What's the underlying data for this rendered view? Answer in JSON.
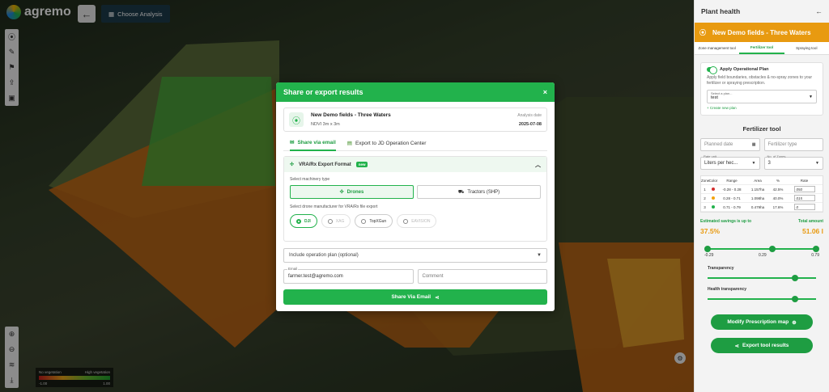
{
  "topbar": {
    "logo_text": "agremo",
    "back_icon": "arrow-left-icon",
    "choose_label": "Choose Analysis"
  },
  "legend": {
    "left": "No vegetation",
    "right": "High vegetation",
    "min": "-1.00",
    "max": "1.00"
  },
  "modal": {
    "title": "Share or export results",
    "close": "×",
    "field_name": "New Demo fields - Three Waters",
    "field_sub": "NDVI 3m x 3m",
    "date_label": "Analysis date",
    "date_value": "2025-07-08",
    "tabs": [
      "Share via email",
      "Export to JD Operation Center"
    ],
    "vra_title": "VRA/Rx Export Format",
    "vra_badge": "new",
    "machinery_label": "Select machinery type",
    "machinery": [
      "Drones",
      "Tractors (SHP)"
    ],
    "drone_label": "Select drone manufacturer for VRA/Rx file export",
    "drones": [
      "DJI",
      "XAG",
      "TopXGun",
      "EAVISION"
    ],
    "operation_plan": "Include operation plan (optional)",
    "email_label": "Email",
    "email_value": "farmer.test@agremo.com",
    "comment_placeholder": "Comment",
    "share_button": "Share Via Email"
  },
  "panel": {
    "title": "Plant health",
    "field_name": "New Demo fields - Three Waters",
    "tabs": [
      "Zone management tool",
      "Fertilizer tool",
      "Spraying tool"
    ],
    "apply_plan": "Apply Operational Plan",
    "apply_desc": "Apply field boundaries, obstacles & no-spray zones to your fertilizer or spraying prescription.",
    "plan_select_label": "Select a plan...",
    "plan_select_value": "test",
    "create_plan": "+ Create new plan",
    "fertilizer_title": "Fertilizer tool",
    "planned_date": "Planned date",
    "fertilizer_type": "Fertilizer type",
    "rate_unit_label": "Rate unit",
    "rate_unit_value": "Liters per hec...",
    "zones_label": "No. of Zones",
    "zones_value": "3",
    "table_headers": [
      "Zone",
      "Color",
      "Range",
      "Area",
      "%",
      "Rate"
    ],
    "rows": [
      {
        "zone": "1",
        "color": "#d32f2f",
        "range": "-0.28 - 0.28",
        "area": "1.157ha",
        "pct": "42.5%",
        "rate": "050"
      },
      {
        "zone": "2",
        "color": "#f4a30c",
        "range": "0.28 - 0.71",
        "area": "1.098ha",
        "pct": "40.0%",
        "rate": "015"
      },
      {
        "zone": "3",
        "color": "#22b24c",
        "range": "0.71 - 0.79",
        "area": "0.479ha",
        "pct": "17.6%",
        "rate": "0"
      }
    ],
    "savings_label": "Estimated savings is up to",
    "savings_value": "37.5%",
    "total_label": "Total amount",
    "total_value": "51.06 l",
    "slider_ticks": [
      "-0.29",
      "0.29",
      "0.79"
    ],
    "transparency": "Transparency",
    "health_transparency": "Health transparency",
    "modify_button": "Modify Prescription map",
    "export_button": "Export tool results"
  }
}
